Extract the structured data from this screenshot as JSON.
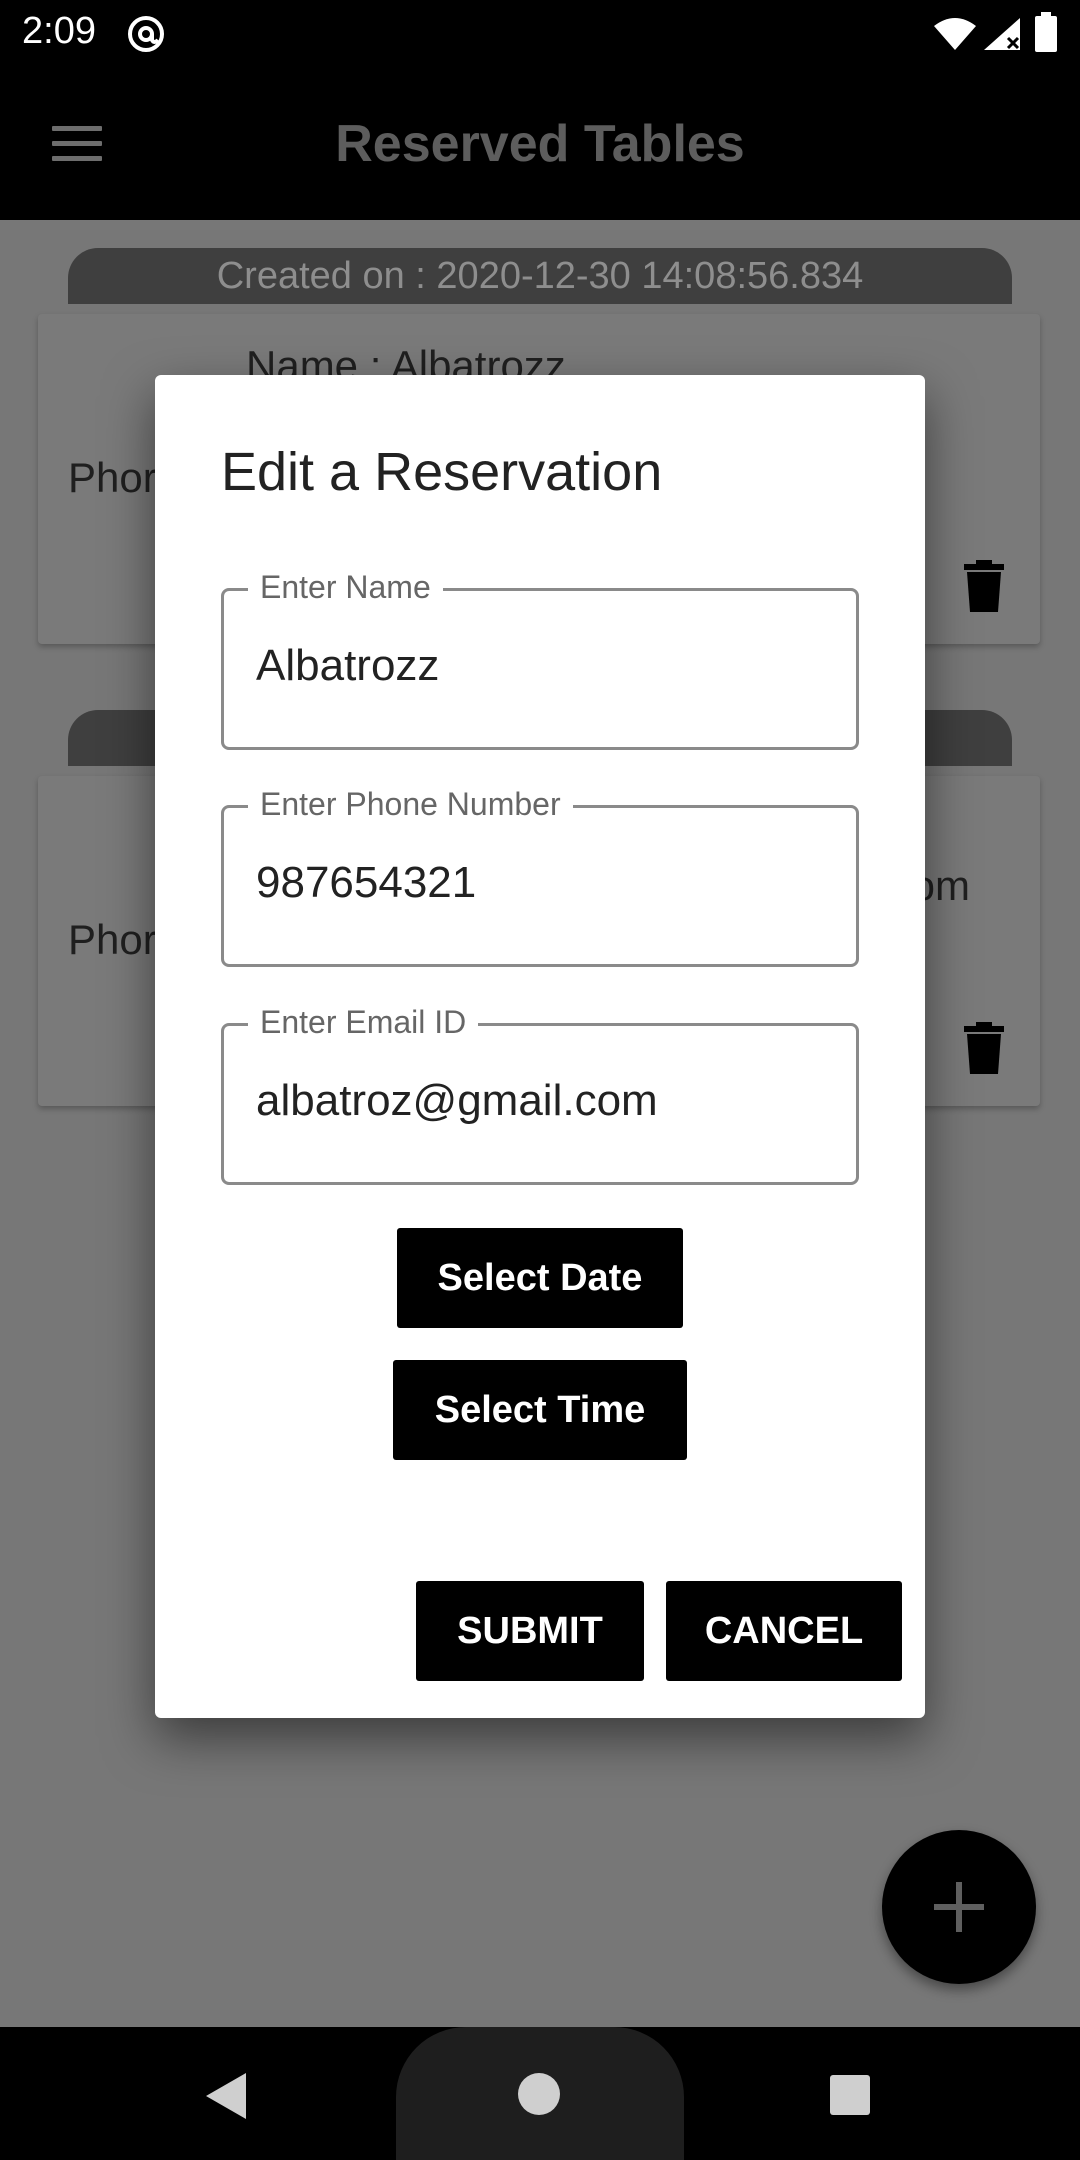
{
  "status": {
    "time": "2:09"
  },
  "app_bar": {
    "title": "Reserved Tables"
  },
  "cards": [
    {
      "created": "Created on : 2020-12-30 14:08:56.834",
      "name": "Name : Albatrozz",
      "phone": "Phor",
      "email": ""
    },
    {
      "created": "",
      "name": "",
      "phone": "Phor",
      "email": "om"
    }
  ],
  "dialog": {
    "title": "Edit a Reservation",
    "fields": {
      "name": {
        "label": "Enter Name",
        "value": "Albatrozz"
      },
      "phone": {
        "label": "Enter Phone Number",
        "value": "987654321"
      },
      "email": {
        "label": "Enter Email ID",
        "value": "albatroz@gmail.com"
      }
    },
    "select_date": "Select Date",
    "select_time": "Select Time",
    "submit": "SUBMIT",
    "cancel": "CANCEL"
  },
  "icons": {
    "menu": "menu-icon",
    "trash": "trash-icon",
    "add": "plus-icon",
    "back": "back-triangle-icon",
    "home": "home-circle-icon",
    "recent": "recents-square-icon"
  }
}
